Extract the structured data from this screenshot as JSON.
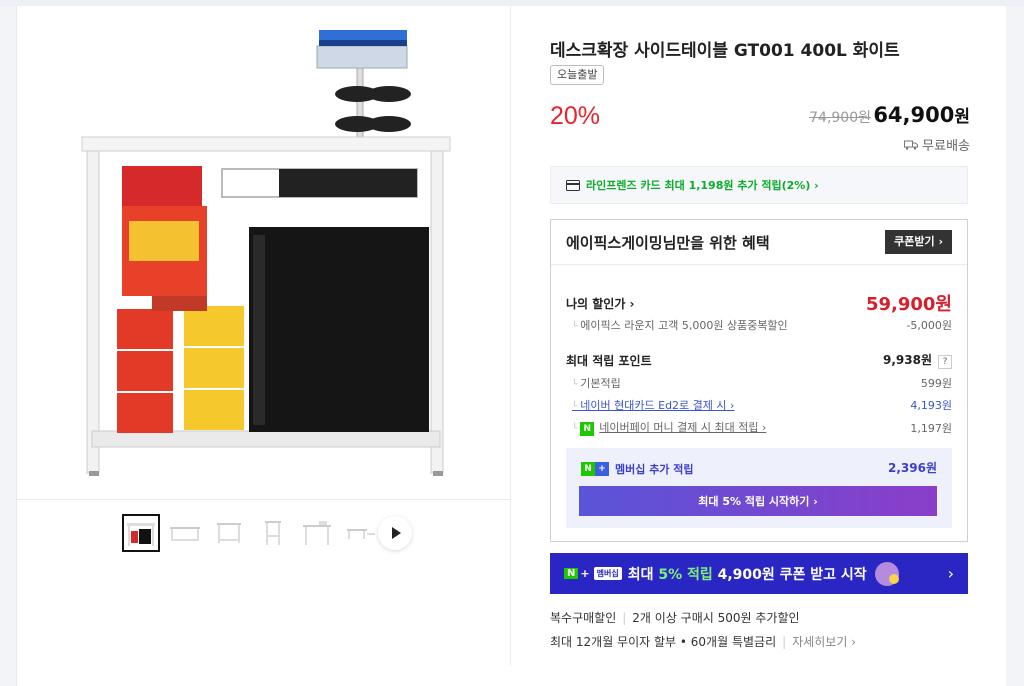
{
  "product": {
    "title": "데스크확장 사이드테이블 GT001 400L 화이트",
    "badge": "오늘출발",
    "discount_rate": "20%",
    "original_price": "74,900원",
    "sale_price_num": "64,900",
    "sale_price_unit": "원",
    "shipping": "무료배송"
  },
  "card_benefit": {
    "text": "라인프렌즈 카드 최대 1,198원 추가 적립(2%) ›"
  },
  "benefit": {
    "title": "에이픽스게이밍님만을 위한 혜택",
    "coupon_button": "쿠폰받기 ›",
    "my_discount_label": "나의 할인가 ›",
    "my_discount_value": "59,900원",
    "lounge_label": "에이픽스 라운지 고객 5,000원 상품중복할인",
    "lounge_value": "-5,000원",
    "max_point_label": "최대 적립 포인트",
    "max_point_value": "9,938원",
    "help": "?",
    "basic_label": "기본적립",
    "basic_value": "599원",
    "card_label": "네이버 현대카드 Ed2로 결제 시 ›",
    "card_value": "4,193원",
    "npay_icon": "N",
    "npay_label": "네이버페이 머니 결제 시 최대 적립 ›",
    "npay_value": "1,197원",
    "membership_label": "멤버십 추가 적립",
    "membership_value": "2,396원",
    "membership_button": "최대 5% 적립 시작하기 ›"
  },
  "banner": {
    "n": "N",
    "plus": "+",
    "pill": "멤버십",
    "text_prefix": "최대 ",
    "text_highlight": "5% 적립",
    "text_suffix": " 4,900원 쿠폰 받고 시작",
    "arrow": "›"
  },
  "multi_buy": {
    "label": "복수구매할인",
    "text": "2개 이상 구매시 500원 추가할인"
  },
  "installment": {
    "text": "최대 12개월 무이자 할부 • 60개월 특별금리",
    "more": "자세히보기 ›"
  },
  "colors": {
    "accent_red": "#e5242f",
    "naver_green": "#1ec800",
    "membership_blue": "#2a26c4"
  }
}
